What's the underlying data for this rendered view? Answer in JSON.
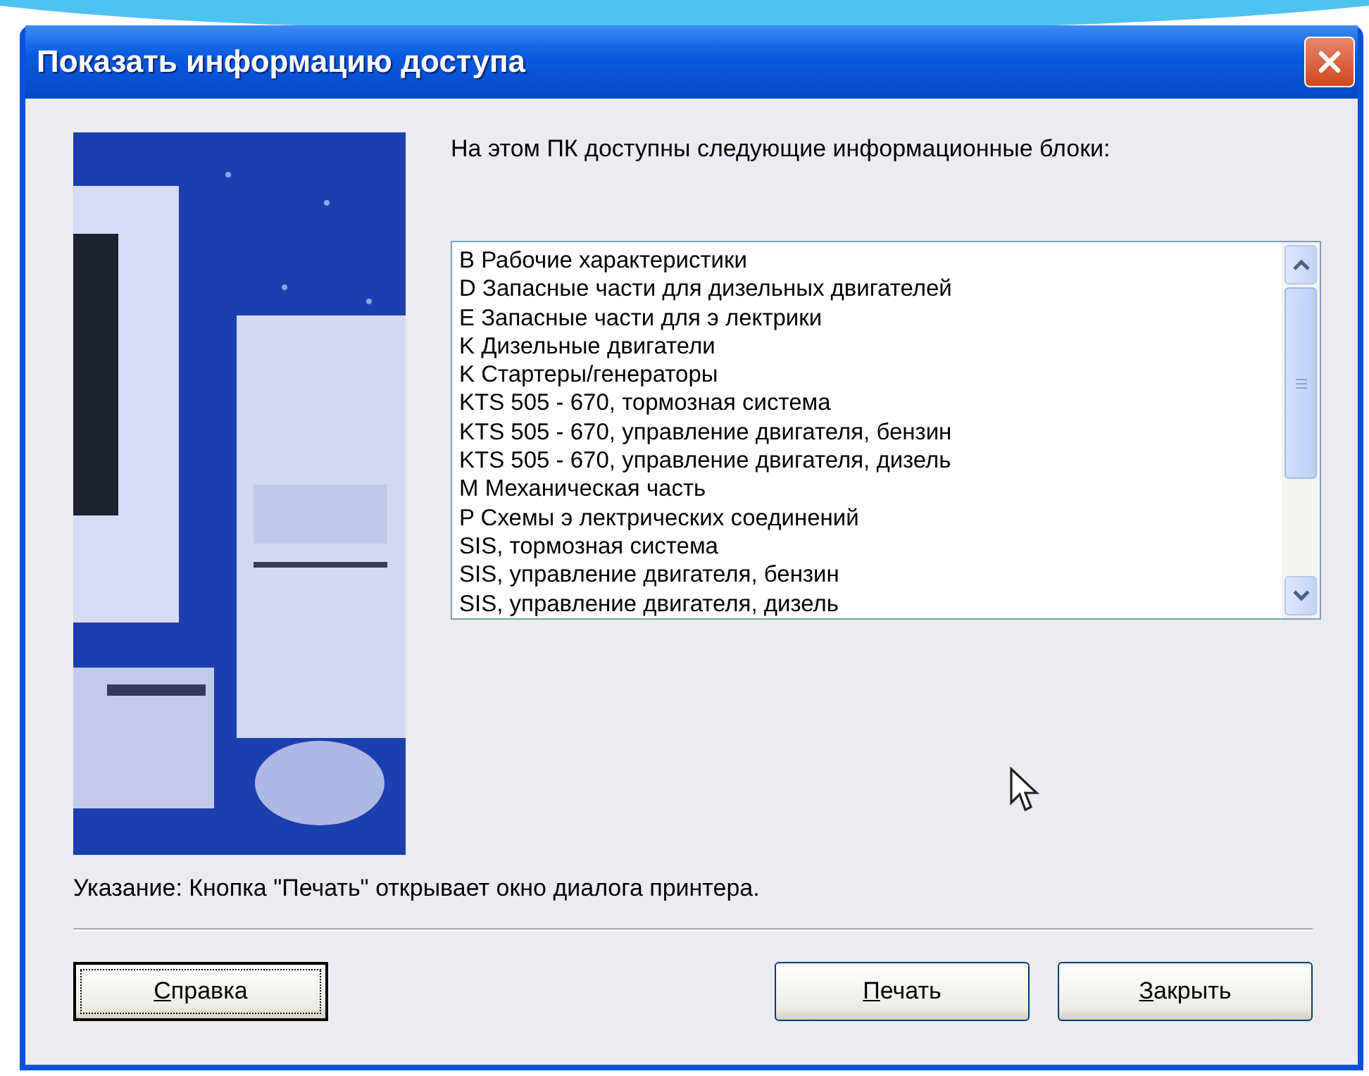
{
  "window": {
    "title": "Показать информацию доступа"
  },
  "intro": "На этом ПК доступны следующие информационные блоки:",
  "list": {
    "items": [
      {
        "label": "B Рабочие характеристики",
        "selected": false
      },
      {
        "label": "D Запасные части для дизельных двигателей",
        "selected": false
      },
      {
        "label": "E Запасные части для э лектрики",
        "selected": false
      },
      {
        "label": "K Дизельные двигатели",
        "selected": false
      },
      {
        "label": "K Стартеры/генераторы",
        "selected": false
      },
      {
        "label": "KTS 505 - 670, тормозная система",
        "selected": false
      },
      {
        "label": "KTS 505 - 670, управление двигателя, бензин",
        "selected": false
      },
      {
        "label": "KTS 505 - 670, управление двигателя, дизель",
        "selected": false
      },
      {
        "label": "M Механическая часть",
        "selected": false
      },
      {
        "label": "P Схемы э лектрических соединений",
        "selected": false
      },
      {
        "label": "SIS, тормозная система",
        "selected": false
      },
      {
        "label": "SIS, управление двигателя, бензин",
        "selected": false
      },
      {
        "label": "SIS, управление двигателя, дизель",
        "selected": false
      }
    ]
  },
  "hint": "Указание: Кнопка \"Печать\" открывает окно диалога принтера.",
  "buttons": [
    {
      "label": "Справка",
      "access_key_underlined": true,
      "focused": true
    },
    {
      "label": "Печать",
      "access_key_underlined": true,
      "focused": false
    },
    {
      "label": "Закрыть",
      "access_key_underlined": true,
      "focused": false
    }
  ]
}
